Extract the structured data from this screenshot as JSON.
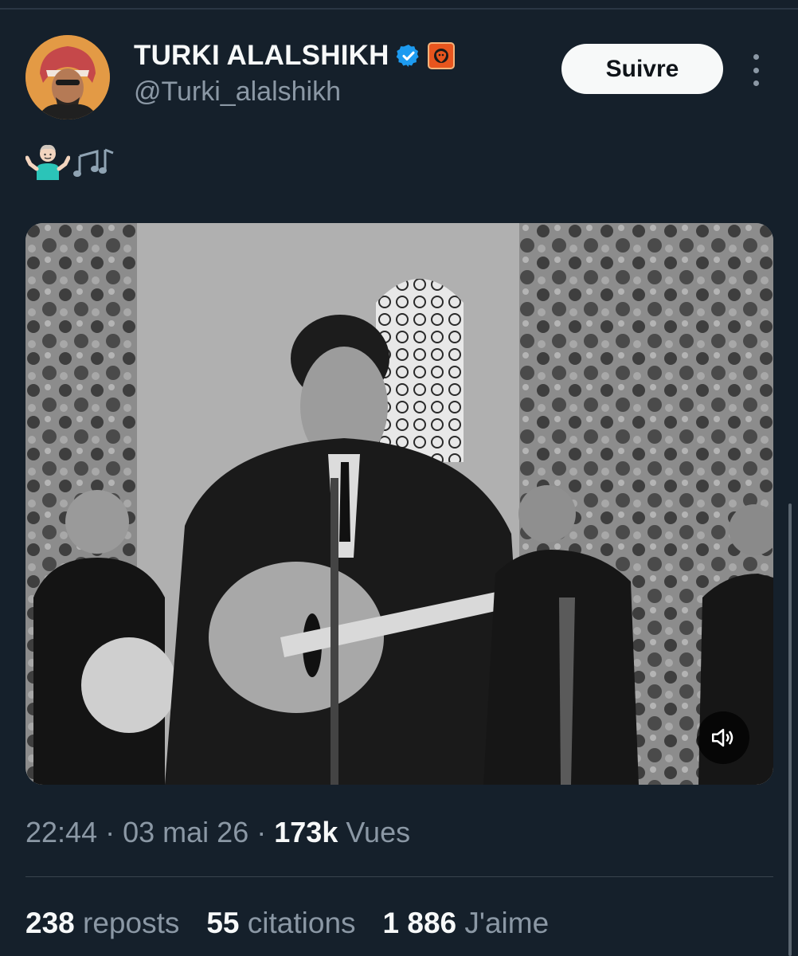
{
  "author": {
    "display_name": "TURKI ALALSHIKH",
    "handle": "@Turki_alalshikh",
    "verified": true,
    "verified_color": "#1d9bf0",
    "affiliation_badge_color": "#e8551e"
  },
  "header": {
    "follow_label": "Suivre"
  },
  "tweet": {
    "text": "🤷🏻‍♂️🎶",
    "media": {
      "type": "video",
      "muted": true
    }
  },
  "meta": {
    "time": "22:44",
    "separator": "·",
    "date": "03 mai 26",
    "views_count": "173k",
    "views_label": "Vues"
  },
  "stats": {
    "reposts": {
      "count": "238",
      "label": "reposts"
    },
    "quotes": {
      "count": "55",
      "label": "citations"
    },
    "likes": {
      "count": "1 886",
      "label": "J'aime"
    }
  },
  "colors": {
    "background": "#15202b",
    "text_primary": "#f7f9f9",
    "text_secondary": "#8b98a5",
    "divider": "#38444d"
  }
}
